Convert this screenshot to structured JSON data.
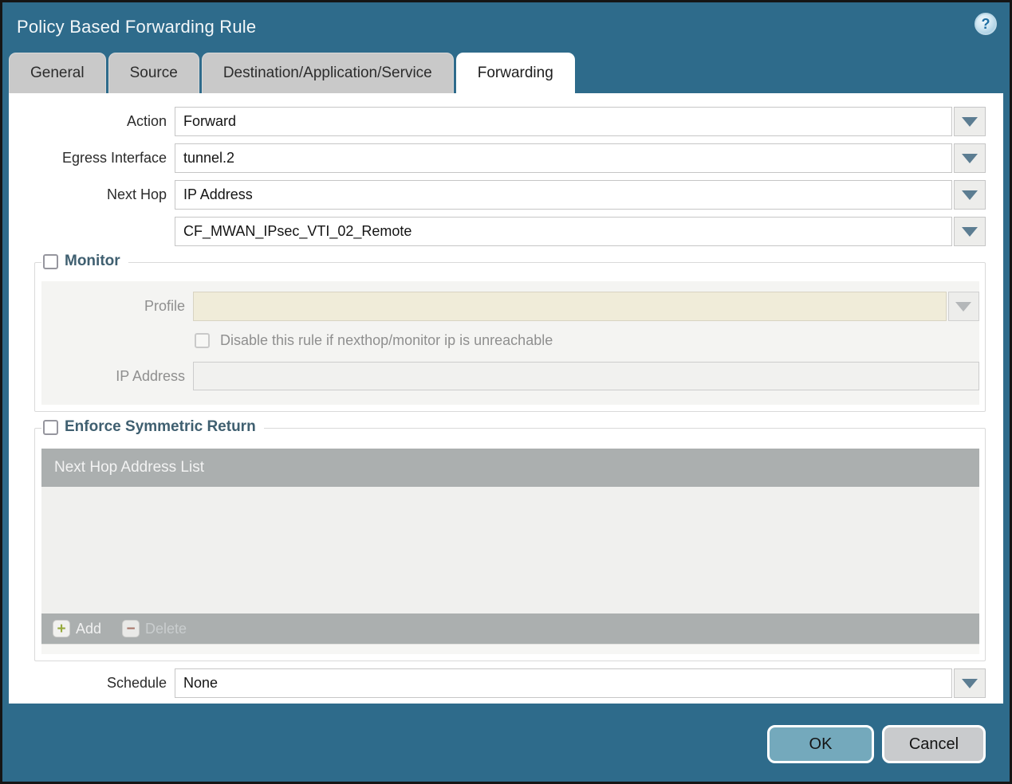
{
  "dialog": {
    "title": "Policy Based Forwarding Rule"
  },
  "tabs": [
    {
      "label": "General",
      "active": false
    },
    {
      "label": "Source",
      "active": false
    },
    {
      "label": "Destination/Application/Service",
      "active": false
    },
    {
      "label": "Forwarding",
      "active": true
    }
  ],
  "form": {
    "action": {
      "label": "Action",
      "value": "Forward"
    },
    "egress_interface": {
      "label": "Egress Interface",
      "value": "tunnel.2"
    },
    "next_hop": {
      "label": "Next Hop",
      "value": "IP Address"
    },
    "next_hop_address": {
      "value": "CF_MWAN_IPsec_VTI_02_Remote"
    },
    "schedule": {
      "label": "Schedule",
      "value": "None"
    }
  },
  "monitor": {
    "legend": "Monitor",
    "checked": false,
    "profile": {
      "label": "Profile",
      "value": ""
    },
    "disable_rule": {
      "label": "Disable this rule if nexthop/monitor ip is unreachable",
      "checked": false
    },
    "ip_address": {
      "label": "IP Address",
      "value": ""
    }
  },
  "enforce_symmetric_return": {
    "legend": "Enforce Symmetric Return",
    "checked": false,
    "table": {
      "header": "Next Hop Address List",
      "rows": []
    },
    "add_label": "Add",
    "delete_label": "Delete"
  },
  "footer": {
    "ok_label": "OK",
    "cancel_label": "Cancel"
  },
  "icons": {
    "help": "?",
    "dropdown": "chevron-down",
    "add": "+",
    "delete": "−"
  },
  "colors": {
    "teal_background": "#2e6b8b",
    "tab_inactive": "#c9c9c9",
    "tab_active": "#ffffff",
    "ok_button": "#74a9bc",
    "cancel_button": "#c9cbcd",
    "table_header": "#abafaf",
    "disabled_field_beige": "#f0ecd9",
    "dropdown_arrow": "#5c7d92",
    "add_icon_green": "#96a93c",
    "delete_icon_red": "#a8766b",
    "legend_text": "#3f5f70"
  }
}
